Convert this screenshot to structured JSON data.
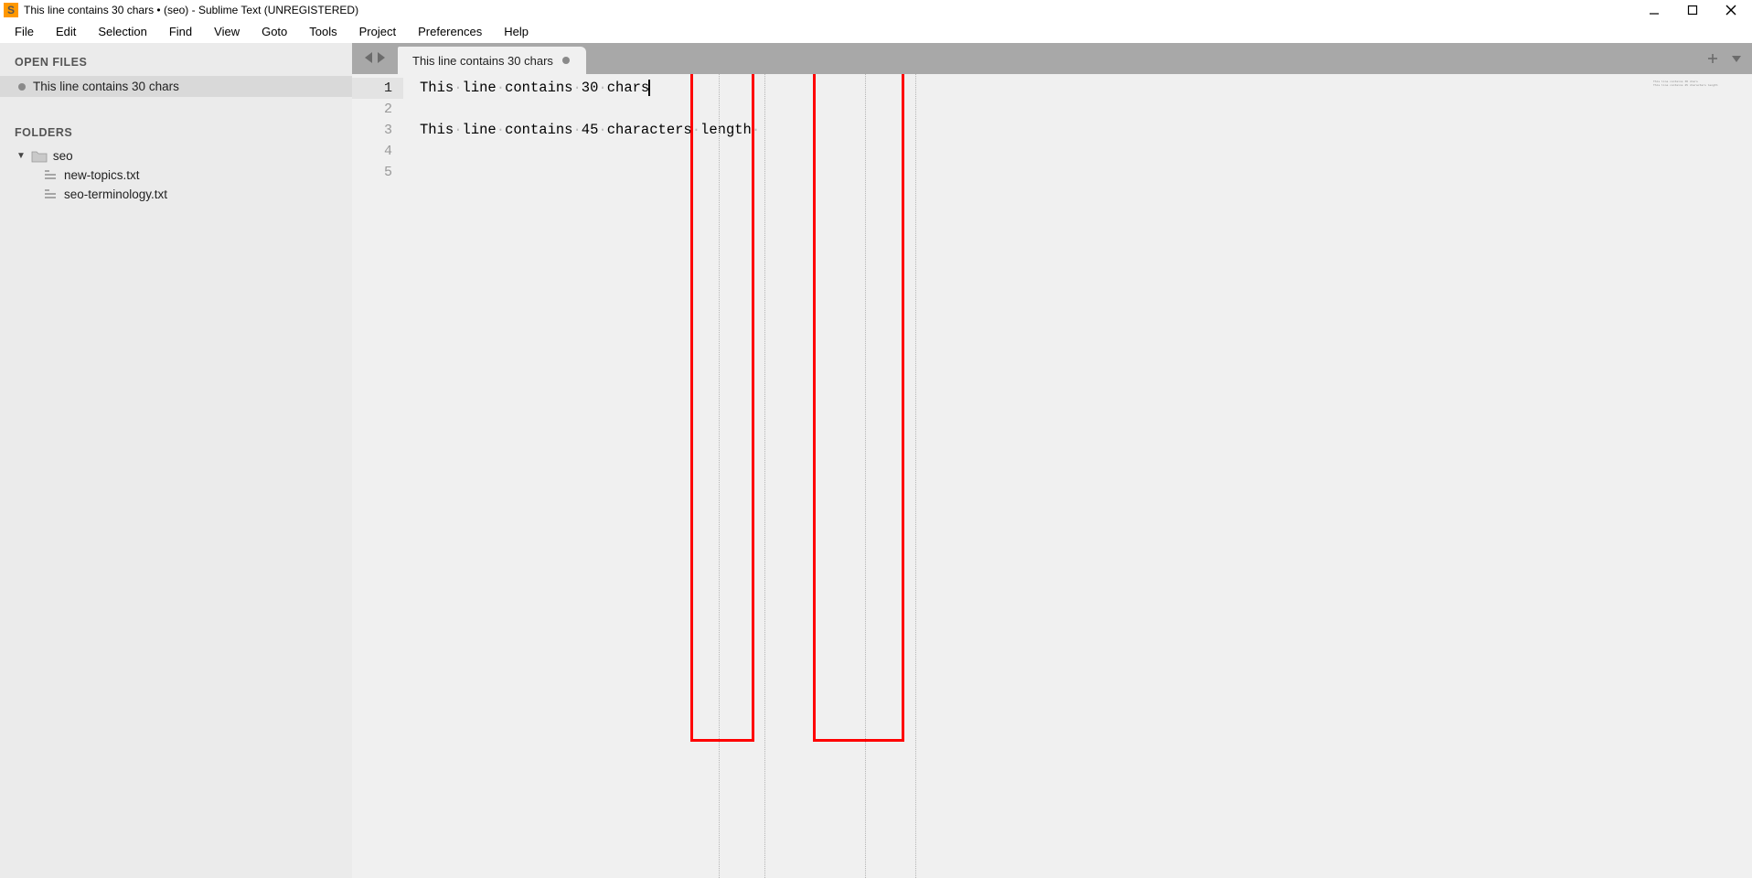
{
  "window": {
    "title": "This line contains 30 chars • (seo) - Sublime Text (UNREGISTERED)"
  },
  "menu": {
    "items": [
      "File",
      "Edit",
      "Selection",
      "Find",
      "View",
      "Goto",
      "Tools",
      "Project",
      "Preferences",
      "Help"
    ]
  },
  "sidebar": {
    "open_files_header": "OPEN FILES",
    "open_files": [
      {
        "label": "This line contains 30 chars",
        "dirty": true
      }
    ],
    "folders_header": "FOLDERS",
    "root_folder": "seo",
    "files": [
      {
        "label": "new-topics.txt"
      },
      {
        "label": "seo-terminology.txt"
      }
    ]
  },
  "tab": {
    "label": "This line contains 30 chars",
    "dirty": true
  },
  "editor": {
    "lines": [
      "This line contains 30 chars",
      "",
      "This line contains 45 characters length",
      "",
      ""
    ],
    "line_numbers": [
      "1",
      "2",
      "3",
      "4",
      "5"
    ],
    "active_line": 1
  }
}
